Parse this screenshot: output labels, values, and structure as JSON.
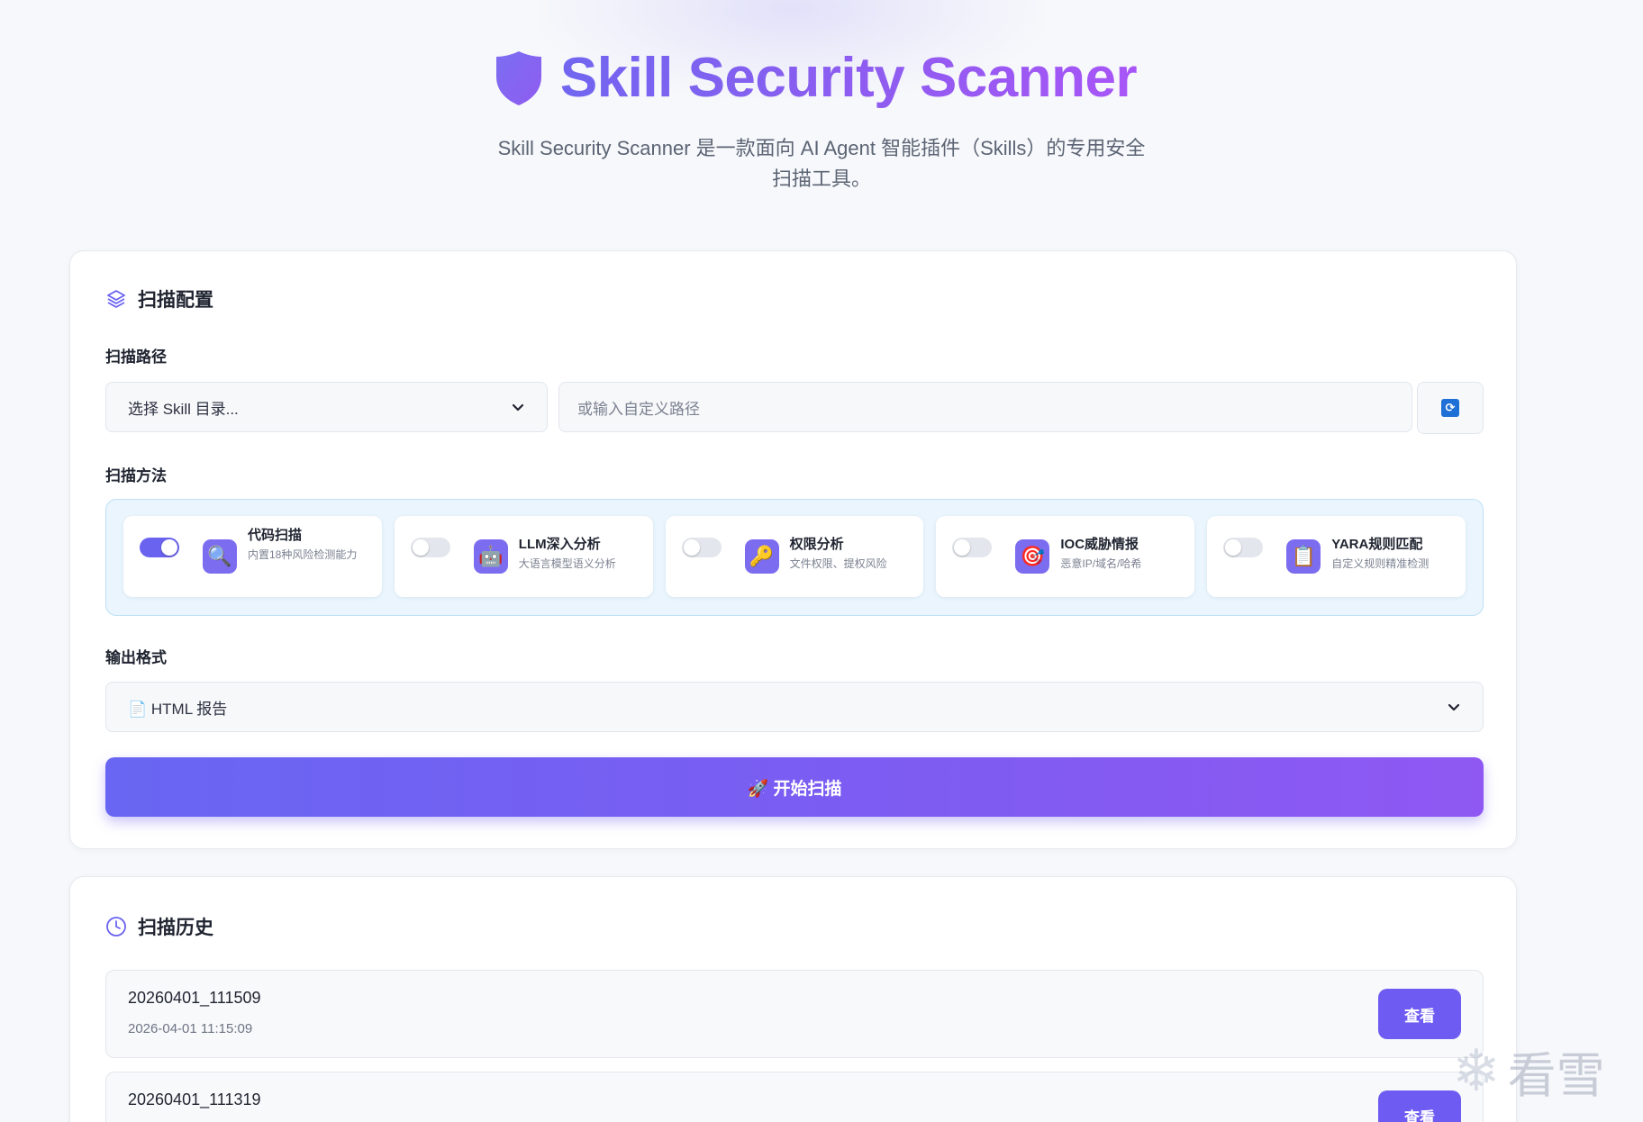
{
  "header": {
    "title": "Skill Security Scanner",
    "subtitle": "Skill Security Scanner 是一款面向 AI Agent 智能插件（Skills）的专用安全扫描工具。"
  },
  "config": {
    "section_title": "扫描配置",
    "section_icon": "layers-icon",
    "path_label": "扫描路径",
    "path_select_value": "选择 Skill 目录...",
    "custom_path_placeholder": "或输入自定义路径",
    "refresh_icon": "refresh-icon",
    "methods_label": "扫描方法",
    "methods": [
      {
        "name": "代码扫描",
        "desc": "内置18种风险检测能力",
        "icon": "🔍",
        "enabled": true
      },
      {
        "name": "LLM深入分析",
        "desc": "大语言模型语义分析",
        "icon": "🤖",
        "enabled": false
      },
      {
        "name": "权限分析",
        "desc": "文件权限、提权风险",
        "icon": "🔑",
        "enabled": false
      },
      {
        "name": "IOC威胁情报",
        "desc": "恶意IP/域名/哈希",
        "icon": "🎯",
        "enabled": false
      },
      {
        "name": "YARA规则匹配",
        "desc": "自定义规则精准检测",
        "icon": "📋",
        "enabled": false
      }
    ],
    "output_label": "输出格式",
    "output_value": "📄 HTML 报告",
    "scan_button_label": "🚀 开始扫描"
  },
  "history": {
    "section_title": "扫描历史",
    "section_icon": "clock-icon",
    "items": [
      {
        "name": "20260401_111509",
        "time": "2026-04-01 11:15:09",
        "action": "查看"
      },
      {
        "name": "20260401_111319",
        "time": "",
        "action": "查看"
      }
    ]
  },
  "watermark": {
    "text": "看雪",
    "icon": "snowflake-icon"
  },
  "colors": {
    "accent": "#6e5cf2",
    "title_gradient_start": "#7166f0",
    "title_gradient_end": "#a855f7",
    "methods_panel_bg": "#eaf5fd"
  }
}
